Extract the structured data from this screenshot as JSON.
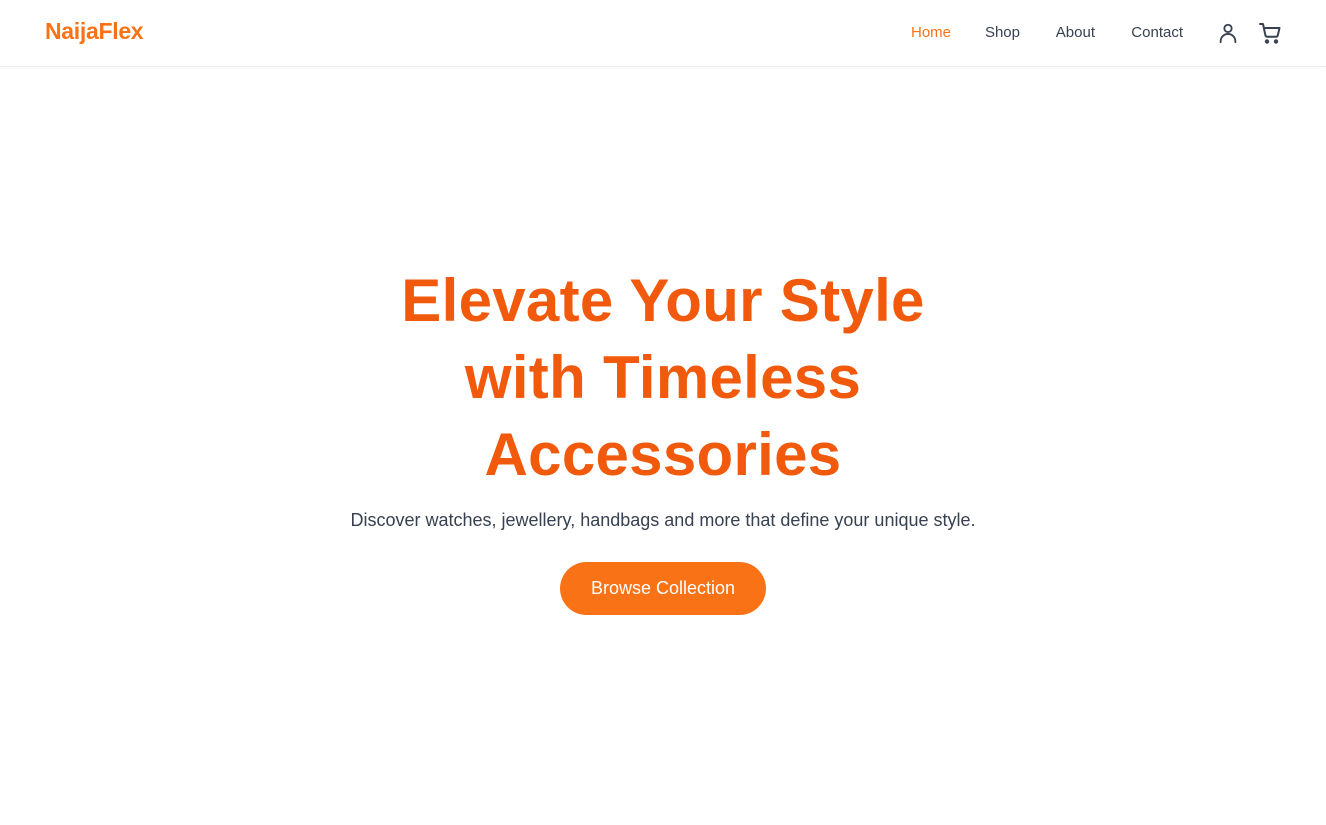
{
  "brand": {
    "name": "NaijaFlex",
    "accent_color": "#f97316",
    "heading_color": "#f15a0c"
  },
  "nav": {
    "items": [
      {
        "label": "Home",
        "active": true
      },
      {
        "label": "Shop",
        "active": false
      },
      {
        "label": "About",
        "active": false
      },
      {
        "label": "Contact",
        "active": false
      }
    ],
    "icons": [
      "user-icon",
      "cart-icon"
    ]
  },
  "hero": {
    "title_lines": [
      "Elevate Your Style",
      "with Timeless",
      "Accessories"
    ],
    "subtitle": "Discover watches, jewellery, handbags and more that define your unique style.",
    "cta_label": "Browse Collection"
  }
}
